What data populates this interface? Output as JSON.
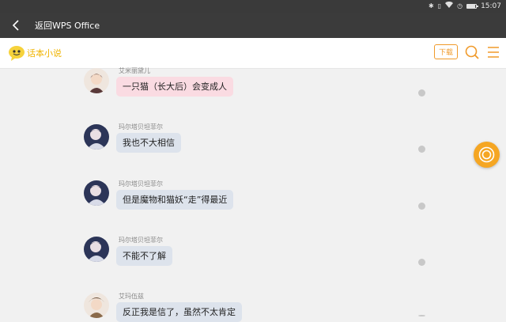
{
  "status_bar": {
    "time": "15:07",
    "battery_level": 0.9,
    "icons": [
      "bluetooth-icon",
      "vibrate-icon",
      "wifi-icon",
      "alarm-icon",
      "battery-icon"
    ]
  },
  "title_bar": {
    "back_icon": "chevron-left-icon",
    "title": "返回WPS Office"
  },
  "app_header": {
    "logo_text": "话本小说",
    "download_label": "下载",
    "accent_color": "#f09a2a"
  },
  "messages": [
    {
      "sender": "艾米丽黛儿",
      "text": "一只猫（长大后）会变成人",
      "style": "pink"
    },
    {
      "sender": "玛尔塔贝坦菲尔",
      "text": "我也不大相信",
      "style": "gray"
    },
    {
      "sender": "玛尔塔贝坦菲尔",
      "text": "但是魔物和猫妖“走”得最近",
      "style": "gray"
    },
    {
      "sender": "玛尔塔贝坦菲尔",
      "text": "不能不了解",
      "style": "gray"
    },
    {
      "sender": "艾玛伍兹",
      "text": "反正我是信了，虽然不太肯定",
      "style": "gray"
    }
  ],
  "colors": {
    "bubble_pink": "#fadbe2",
    "bubble_gray": "#dde3ec",
    "float_button": "#f5a623"
  }
}
